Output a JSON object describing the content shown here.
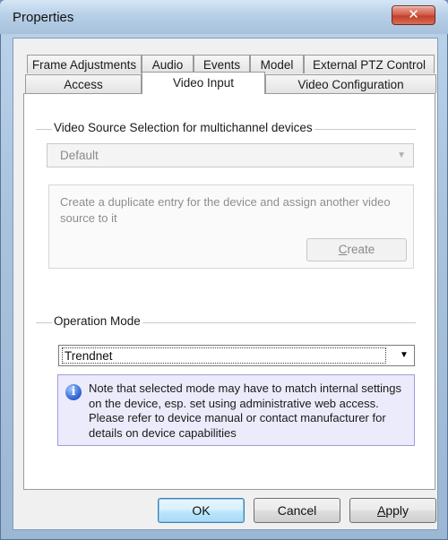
{
  "window": {
    "title": "Properties",
    "close_glyph": "✕"
  },
  "tabs": {
    "row1": [
      "Frame Adjustments",
      "Audio",
      "Events",
      "Model",
      "External PTZ Control"
    ],
    "row2": [
      "Access",
      "Video Input",
      "Video Configuration"
    ],
    "active": "Video Input"
  },
  "video_source": {
    "header": "Video Source Selection for multichannel devices",
    "select_value": "Default",
    "info_text": "Create a duplicate entry for the device and assign another video source to it",
    "create_label_first": "C",
    "create_label_rest": "reate"
  },
  "operation_mode": {
    "header": "Operation Mode",
    "select_value": "Trendnet",
    "note_icon": "info-icon",
    "note_text": "Note that selected mode may have to match internal settings on the device, esp. set using administrative web access. Please refer to device manual or contact manufacturer for details on device capabilities"
  },
  "buttons": {
    "ok": "OK",
    "cancel": "Cancel",
    "apply_first": "A",
    "apply_rest": "pply"
  },
  "colors": {
    "accent": "#3c7fb1",
    "note_border": "#9e9cdb",
    "note_bg": "#ecebfb"
  }
}
